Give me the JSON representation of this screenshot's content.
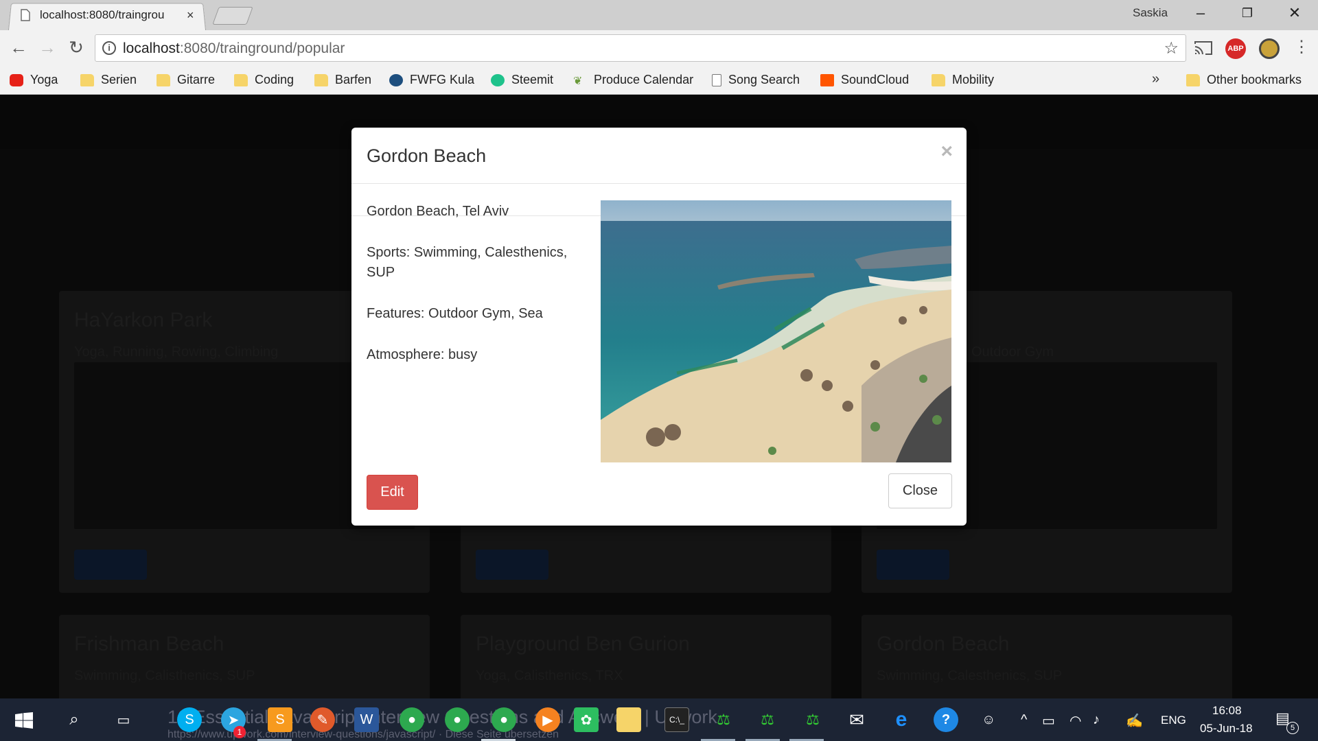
{
  "browser": {
    "tab_title": "localhost:8080/traingrou",
    "tab_close": "×",
    "user": "Saskia",
    "url_host": "localhost",
    "url_rest": ":8080/trainground/popular",
    "ext_abp": "ABP",
    "bookmarks": [
      "Yoga",
      "Serien",
      "Gitarre",
      "Coding",
      "Barfen",
      "FWFG Kula",
      "Steemit",
      "Produce Calendar",
      "Song Search",
      "SoundCloud",
      "Mobility"
    ],
    "bookmarks_more": "»",
    "other_bookmarks": "Other bookmarks"
  },
  "background_cards": [
    {
      "title": "HaYarkon Park",
      "sub": "Yoga, Running, Rowing, Climbing"
    },
    {
      "title": "",
      "sub": ""
    },
    {
      "title": "",
      "sub": "Outdoor Gym"
    },
    {
      "title": "Frishman Beach",
      "sub": "Swimming, Calisthenics, SUP"
    },
    {
      "title": "Playground Ben Gurion",
      "sub": "Yoga, Calisthenics, TRX"
    },
    {
      "title": "Gordon Beach",
      "sub": "Swimming, Calesthenics, SUP"
    }
  ],
  "modal": {
    "title": "Gordon Beach",
    "close_x": "×",
    "location": "Gordon Beach, Tel Aviv",
    "sports": "Sports: Swimming, Calesthenics, SUP",
    "features": "Features: Outdoor Gym, Sea",
    "atmosphere": "Atmosphere: busy",
    "edit_label": "Edit",
    "close_label": "Close"
  },
  "taskbar": {
    "ghost_title": "10 Essential JavaScript Interview Questions and Answers | Upwork",
    "ghost_url": "https://www.upwork.com/interview-questions/javascript/ · Diese Seite übersetzen",
    "telegram_badge": "1",
    "lang": "ENG",
    "time": "16:08",
    "date": "05-Jun-18",
    "notif_count": "5"
  },
  "colors": {
    "edit_button": "#d9534f",
    "chrome_bar": "#f2f2f2",
    "taskbar": "#1c2434"
  }
}
